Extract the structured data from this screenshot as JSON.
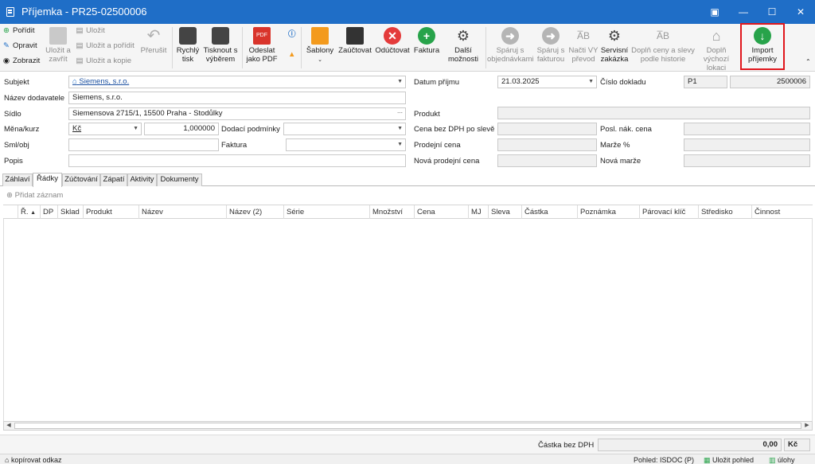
{
  "window": {
    "title": "Příjemka - PR25-02500006",
    "restore_icon": "restore-icon",
    "minimize": "—",
    "maximize": "☐",
    "close": "✕"
  },
  "ribbon": {
    "pridat": "Pořídit",
    "opravit": "Opravit",
    "zobrazit": "Zobrazit",
    "ulozit_zavrit": "Uložit a zavřít",
    "ulozit": "Uložit",
    "ulozit_poridit": "Uložit a pořídit",
    "ulozit_kopie": "Uložit a kopie",
    "prerusit": "Přerušit",
    "rychly_tisk": "Rychlý tisk",
    "tisknout_vyberem": "Tisknout s výběrem",
    "odeslat_pdf": "Odeslat jako PDF",
    "sablony": "Šablony",
    "zauctovat": "Zaúčtovat",
    "oductovat": "Odúčtovat",
    "faktura": "Faktura",
    "dalsi": "Další možnosti",
    "sparuj_obj": "Spáruj s objednávkami",
    "sparuj_fakt": "Spáruj s fakturou",
    "nacti_vy": "Načti VY převod",
    "servisni": "Servisní zakázka",
    "dopln_ceny": "Doplň ceny a slevy podle historie",
    "dopln_vychozi": "Doplň výchozí lokaci",
    "import": "Import příjemky",
    "pdf_badge": "PDF",
    "info_icon": "info-icon",
    "warn_icon": "warning-icon"
  },
  "form": {
    "subjekt_label": "Subjekt",
    "subjekt": "Siemens, s.r.o.",
    "nazev_label": "Název dodavatele",
    "nazev": "Siemens, s.r.o.",
    "sidlo_label": "Sídlo",
    "sidlo": "Siemensova 2715/1, 15500 Praha - Stodůlky",
    "mena_label": "Měna/kurz",
    "mena": "Kč",
    "kurz": "1,000000",
    "dodaci_label": "Dodací podmínky",
    "dodaci": "",
    "sml_label": "Sml/obj",
    "sml": "",
    "faktura_label": "Faktura",
    "faktura": "",
    "popis_label": "Popis",
    "popis": "",
    "datum_label": "Datum příjmu",
    "datum": "21.03.2025",
    "cislo_label": "Číslo dokladu",
    "cislo_prefix": "P1",
    "cislo": "2500006",
    "produkt_label": "Produkt",
    "produkt": "",
    "cena_label": "Cena bez DPH po slevě",
    "cena": "",
    "posl_label": "Posl. nák. cena",
    "posl": "",
    "prodejni_label": "Prodejní cena",
    "prodejni": "",
    "marze_label": "Marže %",
    "marze": "",
    "nova_prodejni_label": "Nová prodejní cena",
    "nova_prodejni": "",
    "nova_marze_label": "Nová marže",
    "nova_marze": ""
  },
  "tabs": [
    "Záhlaví",
    "Řádky",
    "Zúčtování",
    "Zápatí",
    "Aktivity",
    "Dokumenty"
  ],
  "grid": {
    "add": "Přidat záznam",
    "columns": [
      "Ř.",
      "DP",
      "Sklad",
      "Produkt",
      "Název",
      "Název (2)",
      "Série",
      "Množství",
      "Cena",
      "MJ",
      "Sleva",
      "Částka",
      "Poznámka",
      "Párovací klíč",
      "Středisko",
      "Činnost"
    ]
  },
  "summary": {
    "label": "Částka bez DPH",
    "value": "0,00",
    "currency": "Kč"
  },
  "status": {
    "copy_link": "kopírovat odkaz",
    "pohled": "Pohled: ISDOC (P)",
    "ulozit_pohled": "Uložit pohled",
    "ulohy": "úlohy"
  },
  "colors": {
    "titlebar": "#1f6ec7",
    "accent_red": "#e0161c",
    "green": "#27a34a",
    "red": "#e43b3b",
    "orange": "#f39a1d"
  }
}
